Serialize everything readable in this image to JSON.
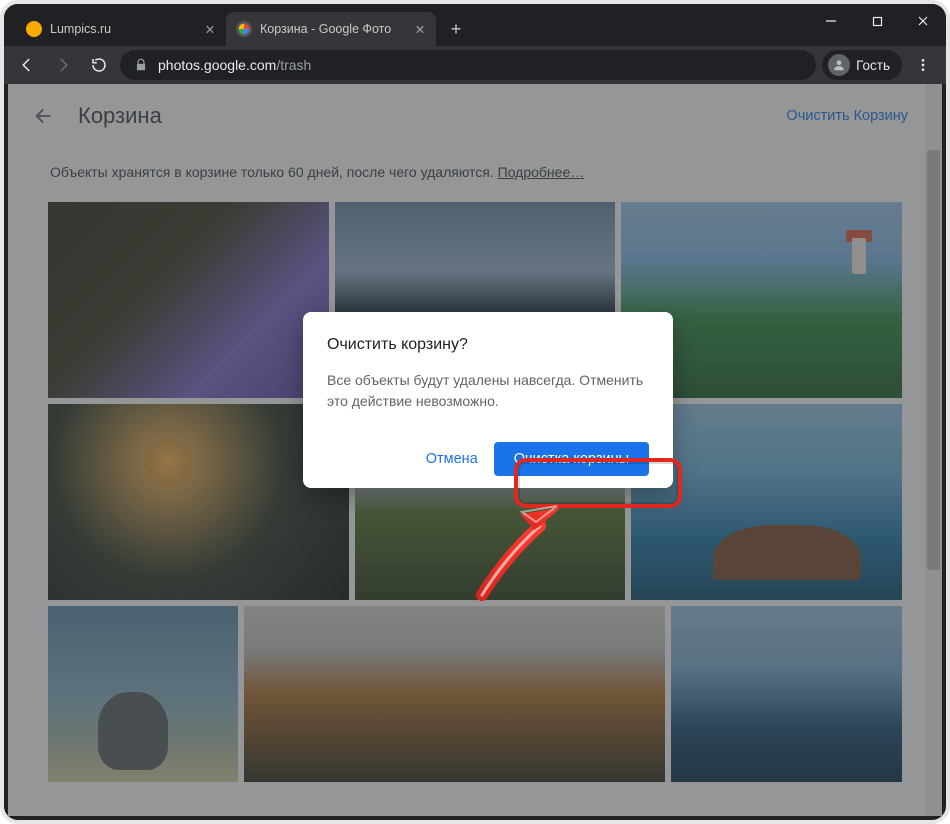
{
  "browser": {
    "tabs": [
      {
        "title": "Lumpics.ru",
        "active": false
      },
      {
        "title": "Корзина - Google Фото",
        "active": true
      }
    ],
    "url": {
      "domain": "photos.google.com",
      "path": "/trash"
    },
    "guest_label": "Гость"
  },
  "page": {
    "title": "Корзина",
    "clear_action": "Очистить Корзину",
    "note_text": "Объекты хранятся в корзине только 60 дней, после чего удаляются. ",
    "note_link": "Подробнее…"
  },
  "dialog": {
    "title": "Очистить корзину?",
    "body": "Все объекты будут удалены навсегда. Отменить это действие невозможно.",
    "cancel": "Отмена",
    "confirm": "Очистка корзины"
  }
}
